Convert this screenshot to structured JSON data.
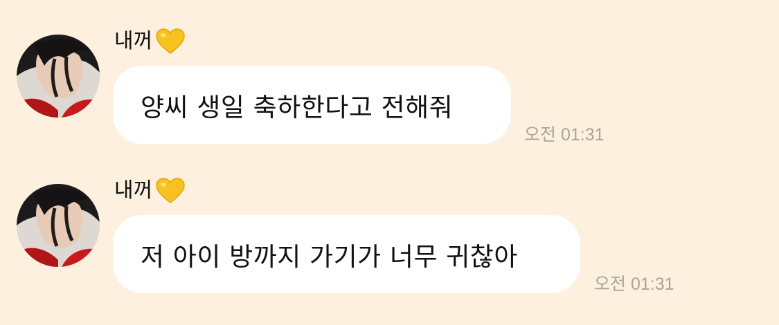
{
  "chat": {
    "messages": [
      {
        "sender": "내꺼",
        "sender_icon": "yellow-heart-icon",
        "text": "양씨 생일 축하한다고 전해줘",
        "time": "오전 01:31"
      },
      {
        "sender": "내꺼",
        "sender_icon": "yellow-heart-icon",
        "text": "저 아이 방까지 가기가 너무 귀찮아",
        "time": "오전 01:31"
      }
    ]
  },
  "colors": {
    "background": "#fdf0df",
    "bubble": "#ffffff",
    "timestamp": "#a9a39c",
    "heart": "#f7c21f"
  }
}
